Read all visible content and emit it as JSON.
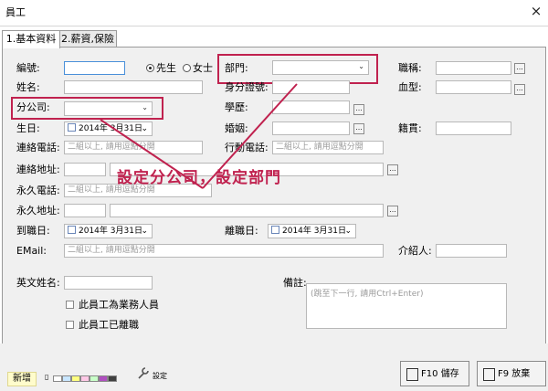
{
  "window": {
    "title": "員工",
    "close_glyph": "×"
  },
  "tabs": [
    {
      "label": "1.基本資料",
      "active": true
    },
    {
      "label": "2.薪資,保險",
      "active": false
    }
  ],
  "form": {
    "number_label": "編號:",
    "gender": {
      "male": "先生",
      "female": "女士",
      "selected": "male"
    },
    "department_label": "部門:",
    "title_label": "職稱:",
    "name_label": "姓名:",
    "id_label": "身分證號:",
    "blood_label": "血型:",
    "branch_label": "分公司:",
    "education_label": "學歷:",
    "birthday_label": "生日:",
    "birthday_value": "2014年 3月31日",
    "marriage_label": "婚姻:",
    "native_label": "籍貫:",
    "contact_phone_label": "連絡電話:",
    "contact_phone_placeholder": "二組以上, 請用逗點分開",
    "mobile_label": "行動電話:",
    "mobile_placeholder": "二組以上, 請用逗點分開",
    "contact_address_label": "連絡地址:",
    "perm_phone_label": "永久電話:",
    "perm_phone_placeholder": "二組以上, 請用逗點分開",
    "perm_address_label": "永久地址:",
    "start_date_label": "到職日:",
    "start_date_value": "2014年 3月31日",
    "leave_date_label": "離職日:",
    "leave_date_value": "2014年 3月31日",
    "email_label": "EMail:",
    "email_placeholder": "二組以上, 請用逗點分開",
    "referrer_label": "介紹人:",
    "english_name_label": "英文姓名:",
    "notes_label": "備註:",
    "notes_placeholder": "(跳至下一行, 請用Ctrl+Enter)",
    "is_sales_label": "此員工為業務人員",
    "is_resigned_label": "此員工已離職",
    "ellipsis": "..."
  },
  "annotation": {
    "text": "設定分公司，設定部門",
    "color": "#c0224f"
  },
  "bottom": {
    "add_label": "新增",
    "colors": [
      "#ffffff",
      "#c8e6ff",
      "#ffff80",
      "#ffc8e6",
      "#c8ffc8",
      "#b050c0",
      "#404040"
    ],
    "settings_label": "設定",
    "save_label": "F10 儲存",
    "cancel_label": "F9 放棄"
  }
}
